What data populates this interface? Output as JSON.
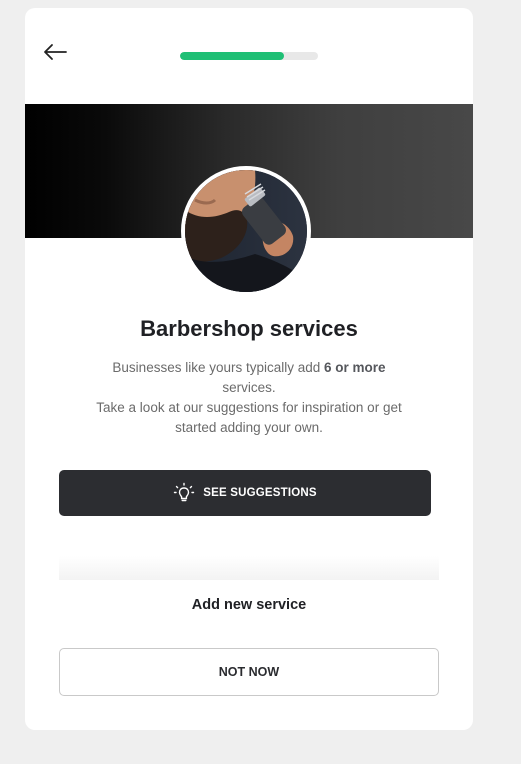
{
  "header": {
    "back_icon": "arrow-left-icon",
    "progress": 0.75,
    "progress_color": "#1fbf75"
  },
  "hero": {
    "avatar_image": "barber-trimming-beard-photo"
  },
  "content": {
    "title": "Barbershop services",
    "desc_part1": "Businesses like yours typically add ",
    "desc_bold": "6 or more",
    "desc_part2": " services.",
    "desc_line3": "Take a look at our suggestions for inspiration or get started adding your own."
  },
  "actions": {
    "suggestions_icon": "lightbulb-icon",
    "suggestions_label": "SEE SUGGESTIONS",
    "add_new_label": "Add new service",
    "not_now_label": "NOT NOW"
  }
}
